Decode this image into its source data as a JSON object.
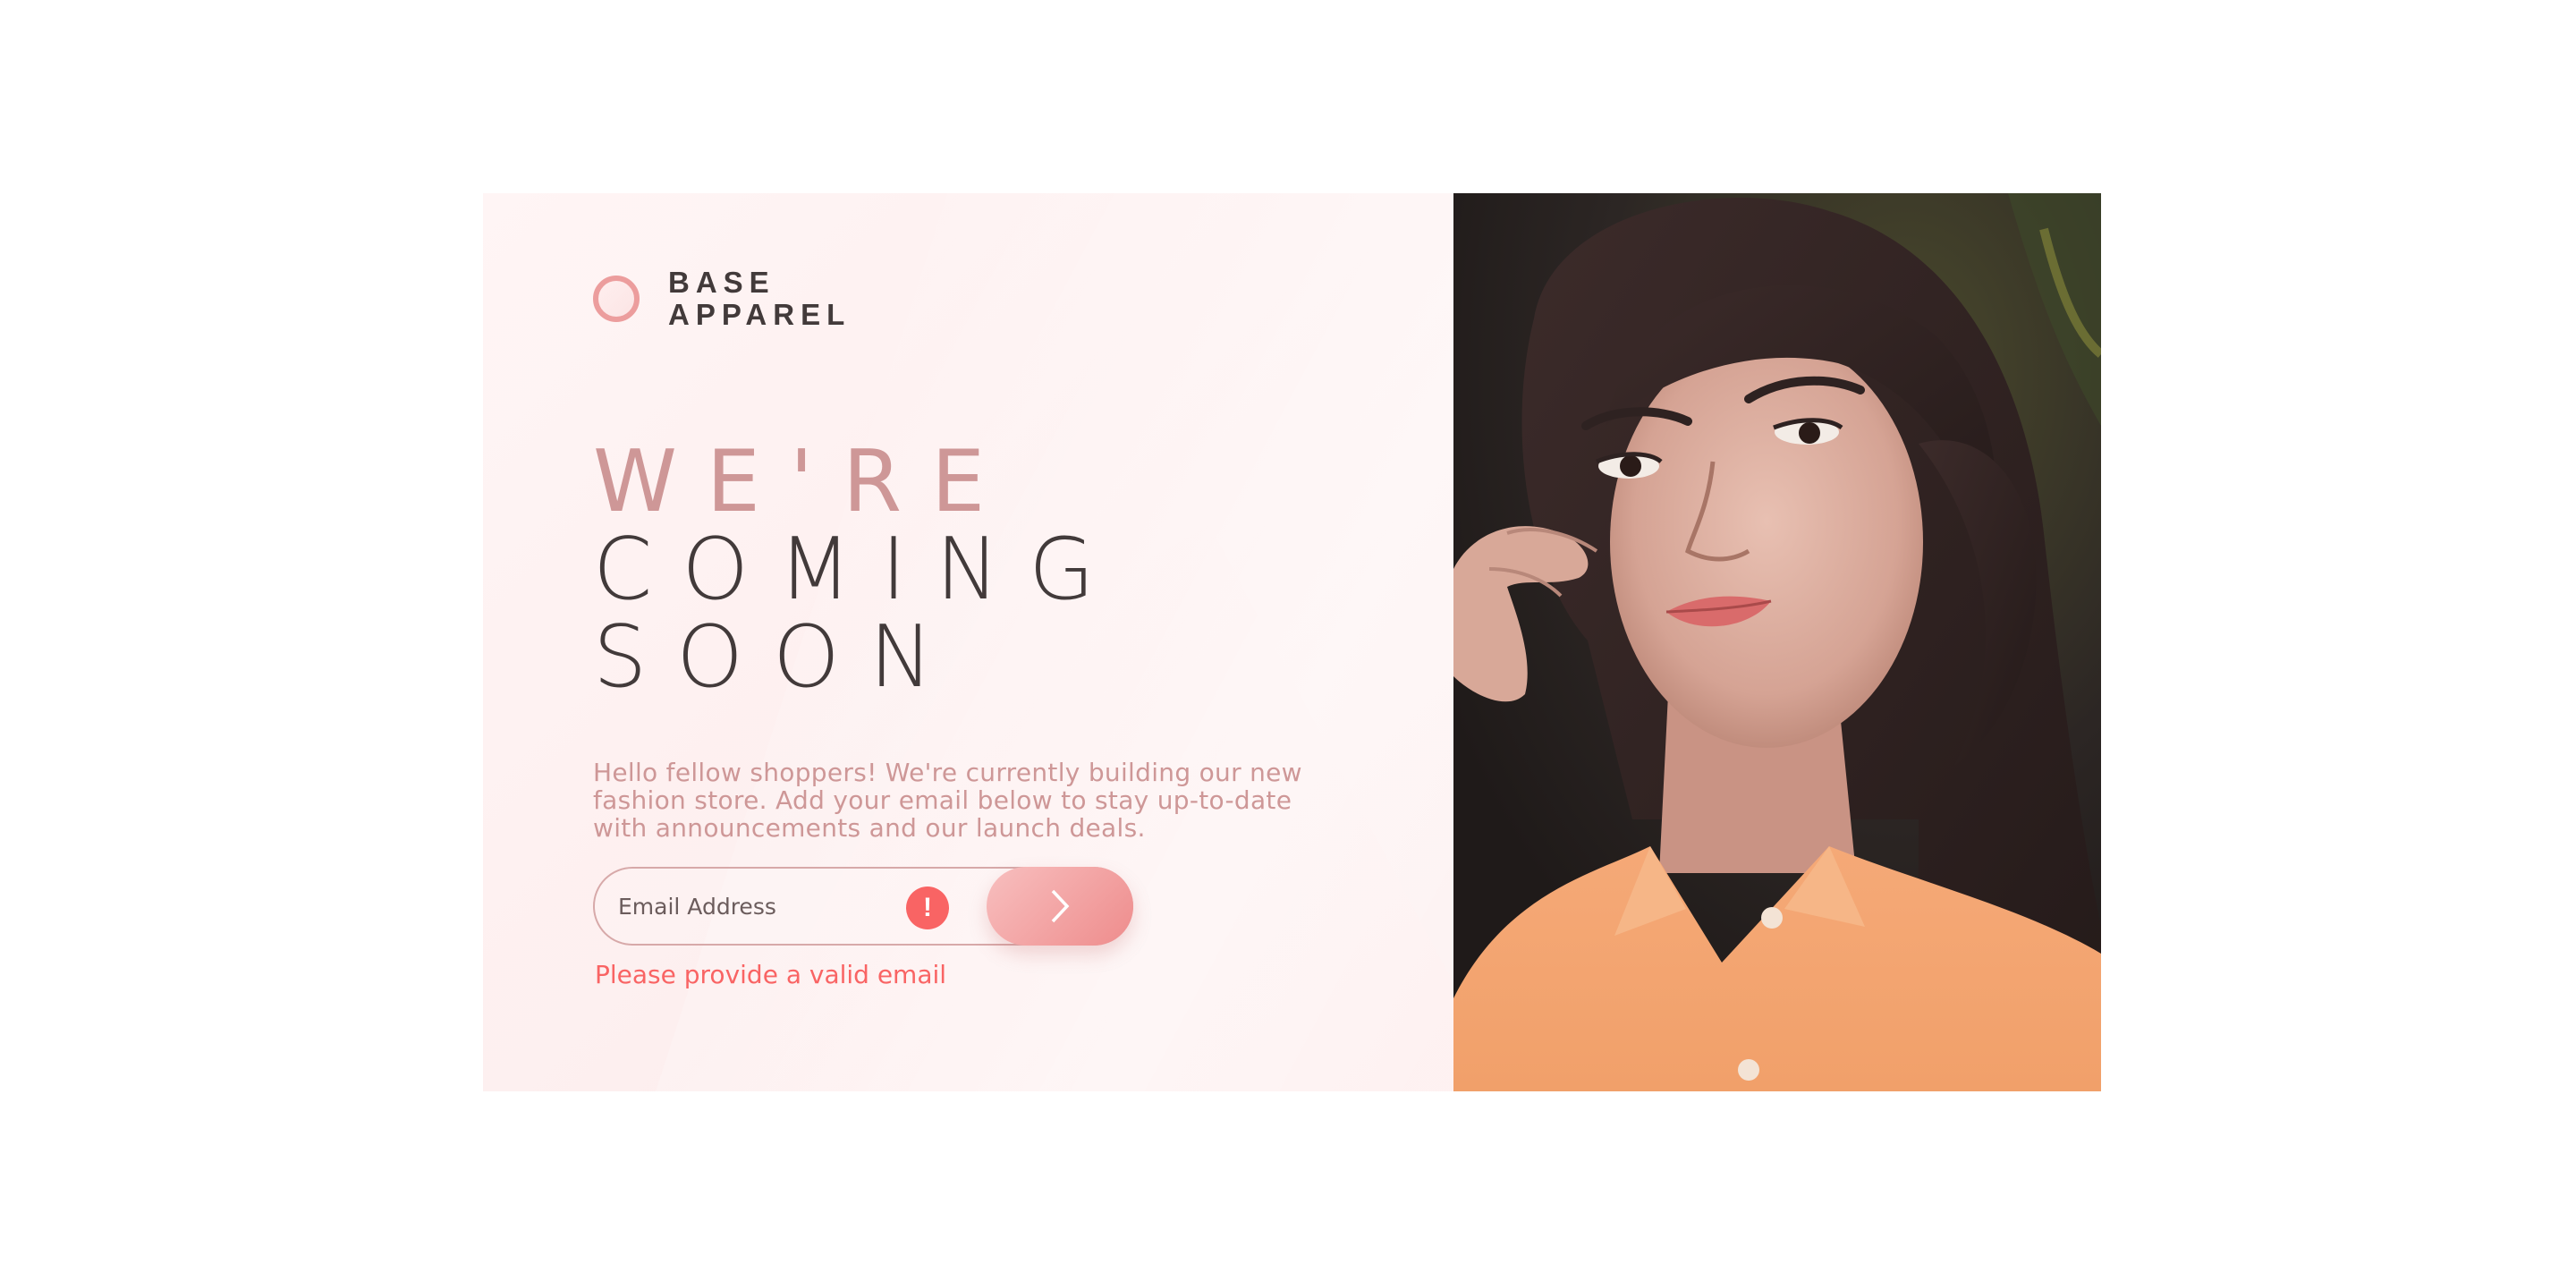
{
  "brand": {
    "line1": "BASE",
    "line2": "APPAREL",
    "accent_color": "#ec9d9d",
    "text_color": "#423a3a"
  },
  "hero": {
    "headline_light": "WE'RE",
    "headline_dark_1": "COMING",
    "headline_dark_2": "SOON",
    "description": "Hello fellow shoppers! We're currently building our new fashion store. Add your email below to stay up-to-date with announcements and our launch deals."
  },
  "form": {
    "email_placeholder": "Email Address",
    "email_value": "",
    "error_icon": "!",
    "submit_icon": "chevron-right-icon",
    "error_message": "Please provide a valid email",
    "error_color": "#f96464"
  },
  "image": {
    "subject": "hero-photo"
  }
}
